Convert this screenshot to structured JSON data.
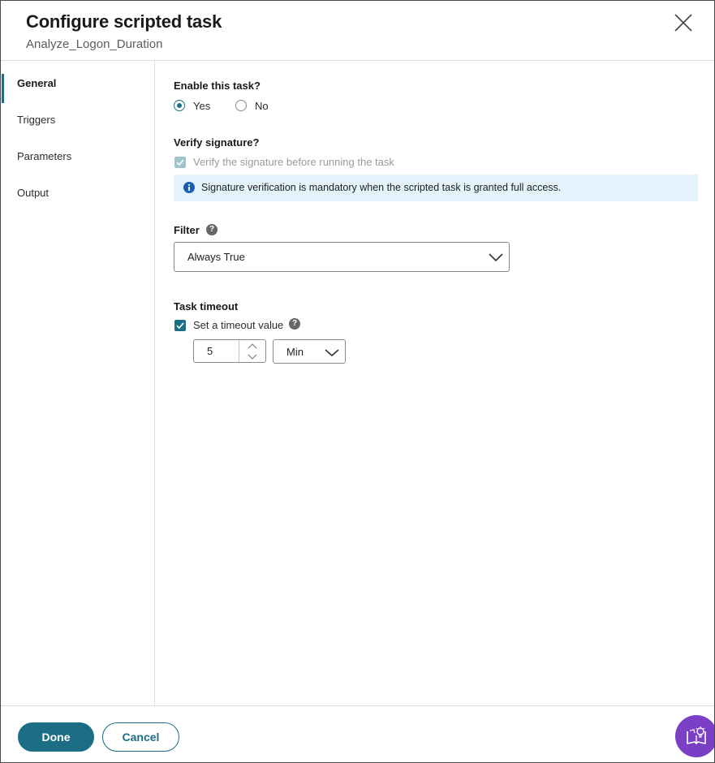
{
  "dialog": {
    "title": "Configure scripted task",
    "subtitle": "Analyze_Logon_Duration"
  },
  "sidebar": {
    "items": [
      {
        "label": "General",
        "active": true
      },
      {
        "label": "Triggers",
        "active": false
      },
      {
        "label": "Parameters",
        "active": false
      },
      {
        "label": "Output",
        "active": false
      }
    ]
  },
  "enable_task": {
    "label": "Enable this task?",
    "options": [
      {
        "label": "Yes",
        "selected": true
      },
      {
        "label": "No",
        "selected": false
      }
    ]
  },
  "verify_signature": {
    "label": "Verify signature?",
    "checkbox_label": "Verify the signature before running the task",
    "checked": true,
    "disabled": true,
    "info_message": "Signature verification is mandatory when the scripted task is granted full access."
  },
  "filter": {
    "label": "Filter",
    "selected": "Always True"
  },
  "task_timeout": {
    "label": "Task timeout",
    "checkbox_label": "Set a timeout value",
    "checked": true,
    "value": "5",
    "unit": "Min"
  },
  "footer": {
    "done_label": "Done",
    "cancel_label": "Cancel"
  },
  "colors": {
    "accent": "#1b6e86",
    "info_background": "#e3f2fb",
    "help_button": "#7a3fc5"
  },
  "icons": {
    "close": "close-icon",
    "info": "info-icon",
    "help": "help-icon",
    "chevron": "chevron-down-icon",
    "guide": "book-lightbulb-icon"
  }
}
